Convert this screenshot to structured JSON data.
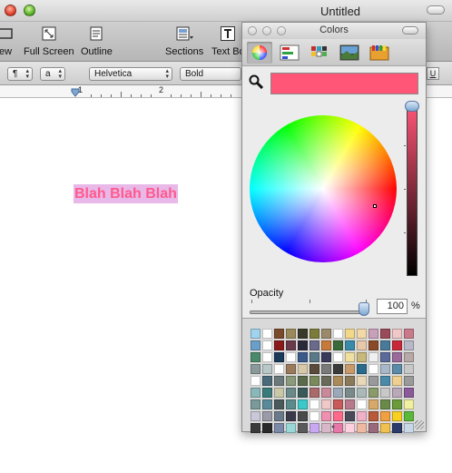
{
  "window": {
    "title": "Untitled"
  },
  "toolbar": {
    "items": [
      {
        "label": "ew",
        "icon": "view-icon"
      },
      {
        "label": "Full Screen",
        "icon": "full-screen-icon"
      },
      {
        "label": "Outline",
        "icon": "outline-icon"
      },
      {
        "label": "Sections",
        "icon": "sections-icon"
      },
      {
        "label": "Text Bo",
        "icon": "text-box-icon"
      }
    ]
  },
  "format_bar": {
    "paragraph_popup": "¶",
    "style_popup": "a",
    "font_popup": "Helvetica",
    "weight_popup": "Bold",
    "underline_button": "U"
  },
  "ruler": {
    "numbers": [
      "1",
      "2"
    ]
  },
  "document": {
    "text": "Blah Blah Blah",
    "text_color": "#ff5a8c",
    "highlight_color": "#e8b8e8"
  },
  "colors_panel": {
    "title": "Colors",
    "selected_mode": "color-wheel",
    "current_color": "#ff5577",
    "opacity_label": "Opacity",
    "opacity_value": "100",
    "opacity_unit": "%",
    "swatches": [
      "#9fd3ee",
      "#ffffff",
      "#7b4a2a",
      "#9a8a5a",
      "#3a3a2a",
      "#7b7b3a",
      "#9b8a6a",
      "#ffffff",
      "#f3d88a",
      "#f3d8a8",
      "#c8a0b8",
      "#9b4a5a",
      "#f0c8c8",
      "#c87a8a",
      "#6aa0c8",
      "#ffffff",
      "#8a1a1a",
      "#6a3a4a",
      "#2a2a3a",
      "#6a6a8a",
      "#c87a3a",
      "#3a6a3a",
      "#3a8aaa",
      "#e8c8a8",
      "#8a4a2a",
      "#4a7a9a",
      "#c8283a",
      "#b8b8c8",
      "#4a8a6a",
      "#ffffff",
      "#1a3a5a",
      "#ffffff",
      "#3a5a8a",
      "#5a7a8a",
      "#3a3a5a",
      "#ffffff",
      "#f0e0a0",
      "#c8b87a",
      "#f0f0f0",
      "#5a6a9a",
      "#9a6a9a",
      "#b8a8a8",
      "#8a9a9a",
      "#b8c8c8",
      "#ffffff",
      "#9a7a5a",
      "#d8c8a8",
      "#5a4a3a",
      "#7a7a7a",
      "#3a3a3a",
      "#c89a6a",
      "#2a6a8a",
      "#ffffff",
      "#a8b8c8",
      "#5a8aaa",
      "#c8c8c8",
      "#ffffff",
      "#4a6a7a",
      "#6a7a7a",
      "#8a9a7a",
      "#5a6a4a",
      "#7a8a5a",
      "#6a6a5a",
      "#aa8a5a",
      "#8a7a5a",
      "#e8d8b8",
      "#9a9a9a",
      "#4a8aa8",
      "#f0d090",
      "#9a9a9a",
      "#8ab8b8",
      "#3a7a7a",
      "#c8c8a8",
      "#6a8a8a",
      "#3a5a5a",
      "#aa6a6a",
      "#c88a9a",
      "#9aa8b8",
      "#7a8a8a",
      "#aab8b8",
      "#8a9a6a",
      "#c8c8c8",
      "#b8a8b8",
      "#8a5a9a",
      "#7a9a9a",
      "#5a8a9a",
      "#4a5a5a",
      "#5a8a8a",
      "#3ac8c8",
      "#ffffff",
      "#f0c8c8",
      "#c85a5a",
      "#b87a8a",
      "#ffffff",
      "#d8a86a",
      "#6a8a4a",
      "#6a9a3a",
      "#f0f0a0",
      "#c8c8d8",
      "#9a9aa8",
      "#6a7a8a",
      "#3a3a4a",
      "#4a4a4a",
      "#ffffff",
      "#f090b0",
      "#ff6a8a",
      "#4a4a5a",
      "#f0b0c8",
      "#b85a3a",
      "#f0a040",
      "#f8d020",
      "#5ab83a",
      "#3a3a3a",
      "#2a2a2a",
      "#7a8aa8",
      "#9ad8d8",
      "#5a5a5a",
      "#c8a8f0",
      "#d8b8c8",
      "#e878a8",
      "#ffd0e0",
      "#f0b8a0",
      "#9a6a7a",
      "#f0c050",
      "#2a3a6a",
      "#c8d8e8"
    ]
  }
}
